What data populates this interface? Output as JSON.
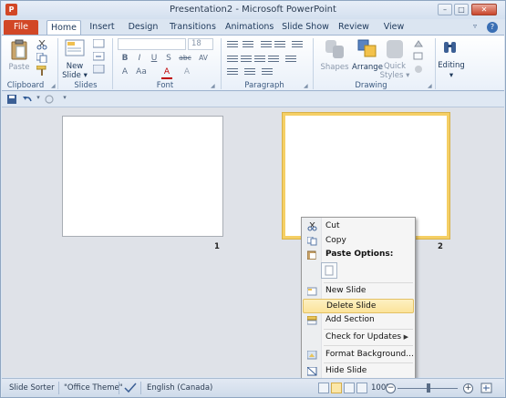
{
  "window": {
    "title": "Presentation2 - Microsoft PowerPoint",
    "app_icon_letter": "P"
  },
  "window_buttons": {
    "minimize": "–",
    "maximize": "□",
    "close": "✕"
  },
  "tabs": [
    {
      "label": "File"
    },
    {
      "label": "Home"
    },
    {
      "label": "Insert"
    },
    {
      "label": "Design"
    },
    {
      "label": "Transitions"
    },
    {
      "label": "Animations"
    },
    {
      "label": "Slide Show"
    },
    {
      "label": "Review"
    },
    {
      "label": "View"
    }
  ],
  "tab_extras": {
    "caret": "▿",
    "help": "?"
  },
  "ribbon": {
    "clipboard": {
      "paste_label": "Paste",
      "group_label": "Clipboard"
    },
    "slides": {
      "new_slide_label_1": "New",
      "new_slide_label_2": "Slide ▾",
      "group_label": "Slides"
    },
    "font": {
      "font_name": "",
      "font_size": "18",
      "group_label": "Font",
      "format_row1": [
        "B",
        "I",
        "U",
        "S",
        "abc",
        "AV"
      ],
      "format_row2": [
        "A",
        "Aa",
        "A",
        "A"
      ]
    },
    "paragraph": {
      "group_label": "Paragraph"
    },
    "drawing": {
      "shapes_label": "Shapes",
      "arrange_label": "Arrange",
      "quick_styles_label_1": "Quick",
      "quick_styles_label_2": "Styles ▾",
      "group_label": "Drawing"
    },
    "editing": {
      "label": "Editing"
    }
  },
  "slides": [
    {
      "number": "1",
      "selected": false
    },
    {
      "number": "2",
      "selected": true
    }
  ],
  "context_menu": {
    "items": [
      {
        "label": "Cut",
        "icon": "scissors-icon"
      },
      {
        "label": "Copy",
        "icon": "copy-icon"
      },
      {
        "label": "Paste Options:",
        "icon": "paste-icon"
      },
      {
        "label": "New Slide",
        "icon": "new-slide-icon"
      },
      {
        "label": "Delete Slide",
        "icon": "delete-slide-icon",
        "highlighted": true
      },
      {
        "label": "Add Section",
        "icon": "add-section-icon"
      },
      {
        "label": "Check for Updates",
        "icon": "",
        "submenu_arrow": "▶"
      },
      {
        "label": "Format Background...",
        "icon": "format-background-icon"
      },
      {
        "label": "Hide Slide",
        "icon": "hide-slide-icon"
      }
    ]
  },
  "statusbar": {
    "view_label": "Slide Sorter",
    "theme_label": "\"Office Theme\"",
    "language_label": "English (Canada)",
    "zoom_label": "100%",
    "zoom_minus": "−",
    "zoom_plus": "+"
  },
  "colors": {
    "file_tab": "#d24726",
    "selection_gold": "#f5cf65",
    "menu_highlight": "#fbe39a"
  }
}
